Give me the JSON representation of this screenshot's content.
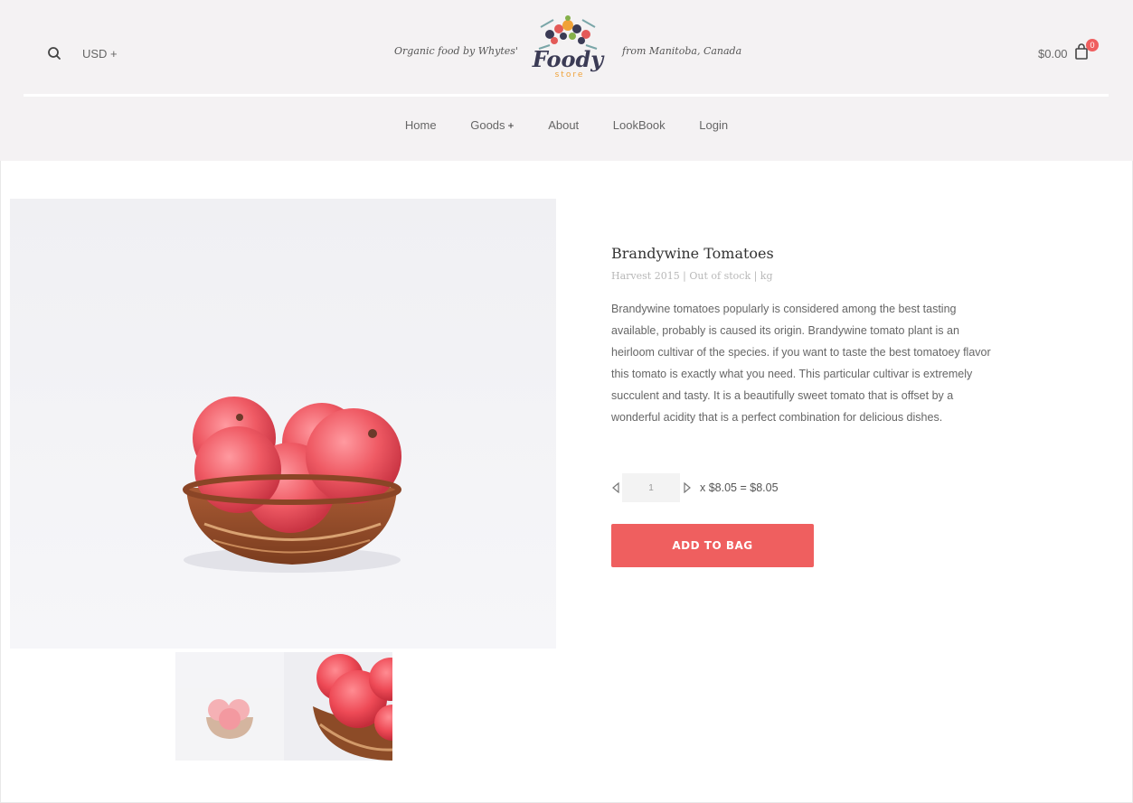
{
  "header": {
    "currency": "USD +",
    "tagline_left": "Organic food by Whytes'",
    "tagline_right": "from Manitoba, Canada",
    "logo_text": "Foody",
    "logo_sub": "store",
    "cart_total": "$0.00",
    "cart_count": "0"
  },
  "nav": {
    "items": [
      {
        "label": "Home"
      },
      {
        "label": "Goods",
        "suffix": "+"
      },
      {
        "label": "About"
      },
      {
        "label": "LookBook"
      },
      {
        "label": "Login"
      }
    ]
  },
  "product": {
    "title": "Brandywine Tomatoes",
    "meta": "Harvest 2015 | Out of stock | kg",
    "description": "Brandywine tomatoes popularly is considered among the best tasting available, probably is caused its origin. Brandywine tomato plant is an heirloom cultivar of the species. if you want to taste the best tomatoey flavor this tomato is exactly what you need. This particular cultivar is extremely succulent and tasty. It is a beautifully sweet tomato that is offset by a wonderful acidity that is a perfect combination for delicious dishes.",
    "quantity": "1",
    "price_line": "x $8.05 = $8.05",
    "add_button": "ADD TO BAG"
  },
  "colors": {
    "accent": "#ef5f5f",
    "header_bg": "#f4f2f3"
  },
  "icons": {
    "search": "search-icon",
    "cart": "shopping-bag-icon",
    "qty_decrease": "triangle-left-icon",
    "qty_increase": "triangle-right-icon"
  }
}
